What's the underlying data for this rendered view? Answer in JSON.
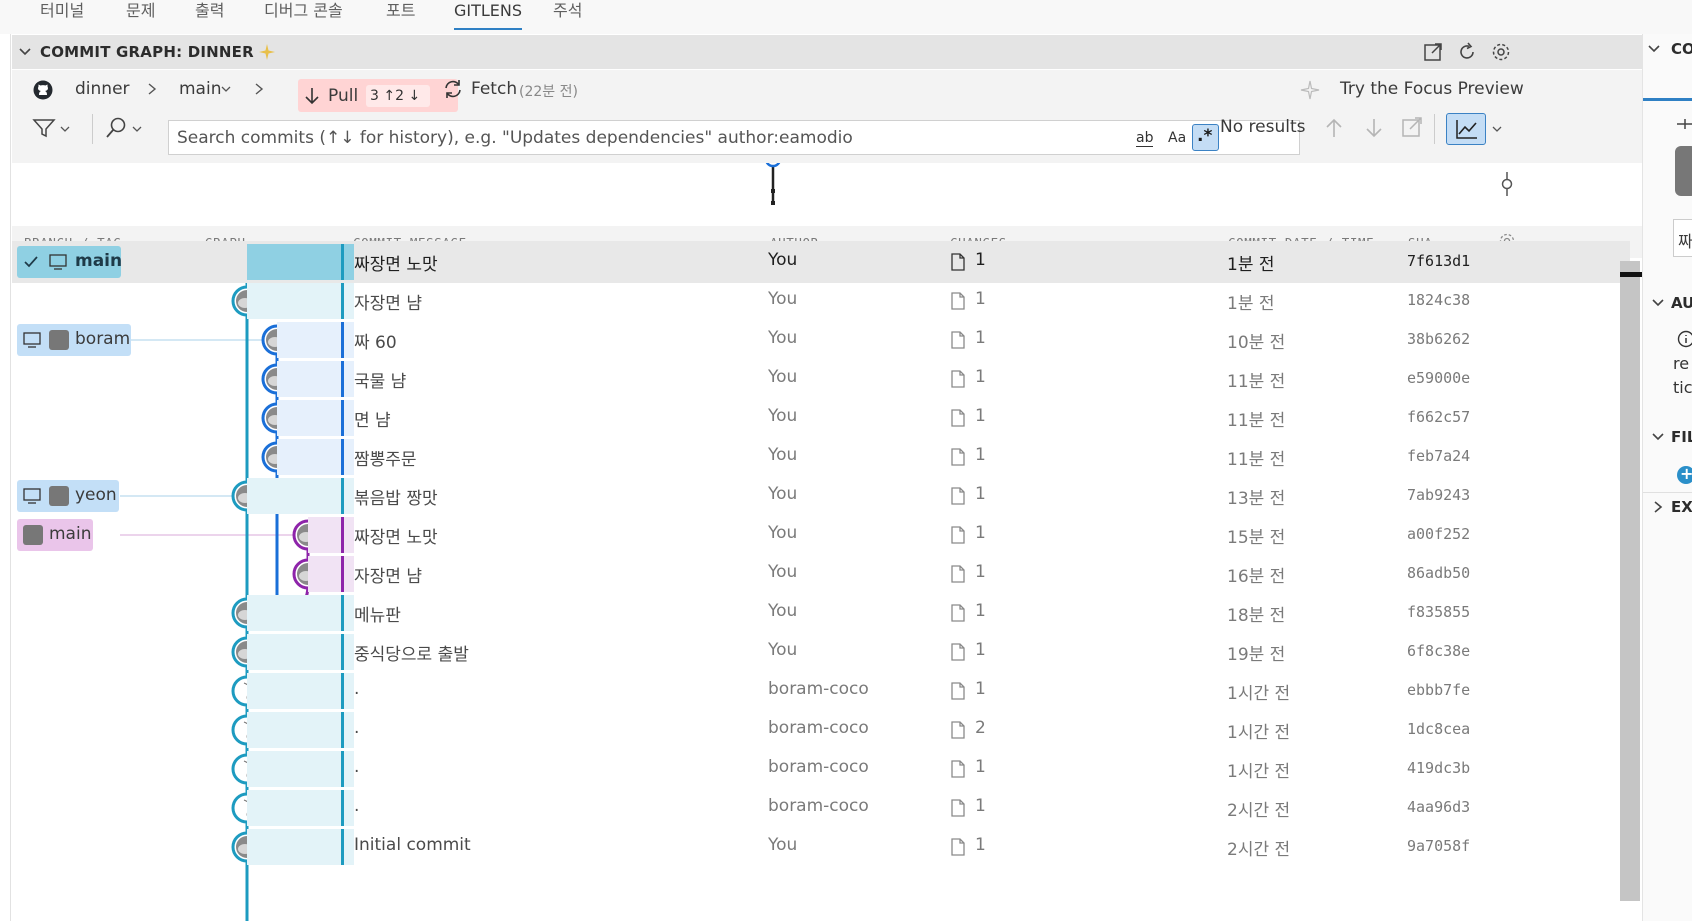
{
  "panel_tabs": [
    {
      "label": "터미널"
    },
    {
      "label": "문제"
    },
    {
      "label": "출력"
    },
    {
      "label": "디버그 콘솔"
    },
    {
      "label": "포트"
    },
    {
      "label": "GITLENS",
      "active": true
    },
    {
      "label": "주석"
    }
  ],
  "section": {
    "title": "COMMIT GRAPH: DINNER"
  },
  "toolbar": {
    "repo": "dinner",
    "branch": "main",
    "pull_label": "Pull",
    "pull_counts": "3 ↑2 ↓",
    "fetch_label": "Fetch",
    "fetch_time": "(22분 전)",
    "focus_preview": "Try the Focus Preview",
    "search_placeholder": "Search commits (↑↓ for history), e.g. \"Updates dependencies\" author:eamodio",
    "match_word": "ab",
    "match_case": "Aa",
    "regex": ".*",
    "results": "No results"
  },
  "columns": {
    "branch": "BRANCH / TAG",
    "graph": "GRAPH",
    "message": "COMMIT MESSAGE",
    "author": "AUTHOR",
    "changes": "CHANGES",
    "date": "COMMIT DATE / TIME",
    "sha": "SHA"
  },
  "commits": [
    {
      "message": "짜장면 노맛",
      "author": "You",
      "changes": "1",
      "date": "1분 전",
      "sha": "7f613d1",
      "selected": true,
      "lane": 0,
      "color": "#1d9bc0",
      "avatar": "photo",
      "chip": {
        "label": "main",
        "kind": "current"
      }
    },
    {
      "message": "자장면 냠",
      "author": "You",
      "changes": "1",
      "date": "1분 전",
      "sha": "1824c38",
      "lane": 0,
      "color": "#1d9bc0",
      "avatar": "photo"
    },
    {
      "message": "짜 60",
      "author": "You",
      "changes": "1",
      "date": "10분 전",
      "sha": "38b6262",
      "lane": 1,
      "color": "#1a6fd8",
      "avatar": "photo",
      "chip": {
        "label": "boram",
        "kind": "local"
      }
    },
    {
      "message": "국물 냠",
      "author": "You",
      "changes": "1",
      "date": "11분 전",
      "sha": "e59000e",
      "lane": 1,
      "color": "#1a6fd8",
      "avatar": "photo"
    },
    {
      "message": "면 냠",
      "author": "You",
      "changes": "1",
      "date": "11분 전",
      "sha": "f662c57",
      "lane": 1,
      "color": "#1a6fd8",
      "avatar": "photo"
    },
    {
      "message": "짬뽕주문",
      "author": "You",
      "changes": "1",
      "date": "11분 전",
      "sha": "feb7a24",
      "lane": 1,
      "color": "#1a6fd8",
      "avatar": "photo"
    },
    {
      "message": "볶음밥 짱맛",
      "author": "You",
      "changes": "1",
      "date": "13분 전",
      "sha": "7ab9243",
      "lane": 0,
      "color": "#1d9bc0",
      "avatar": "photo",
      "chip": {
        "label": "yeon",
        "kind": "local"
      }
    },
    {
      "message": "짜장면 노맛",
      "author": "You",
      "changes": "1",
      "date": "15분 전",
      "sha": "a00f252",
      "lane": 2,
      "color": "#8e24aa",
      "avatar": "photo",
      "chip": {
        "label": "main",
        "kind": "remote"
      }
    },
    {
      "message": "자장면 냠",
      "author": "You",
      "changes": "1",
      "date": "16분 전",
      "sha": "86adb50",
      "lane": 2,
      "color": "#8e24aa",
      "avatar": "photo"
    },
    {
      "message": "메뉴판",
      "author": "You",
      "changes": "1",
      "date": "18분 전",
      "sha": "f835855",
      "lane": 0,
      "color": "#1d9bc0",
      "avatar": "photo"
    },
    {
      "message": "중식당으로 출발",
      "author": "You",
      "changes": "1",
      "date": "19분 전",
      "sha": "6f8c38e",
      "lane": 0,
      "color": "#1d9bc0",
      "avatar": "photo"
    },
    {
      "message": ".",
      "author": "boram-coco",
      "changes": "1",
      "date": "1시간 전",
      "sha": "ebbb7fe",
      "lane": 0,
      "color": "#1d9bc0",
      "avatar": "face"
    },
    {
      "message": ".",
      "author": "boram-coco",
      "changes": "2",
      "date": "1시간 전",
      "sha": "1dc8cea",
      "lane": 0,
      "color": "#1d9bc0",
      "avatar": "face"
    },
    {
      "message": ".",
      "author": "boram-coco",
      "changes": "1",
      "date": "1시간 전",
      "sha": "419dc3b",
      "lane": 0,
      "color": "#1d9bc0",
      "avatar": "face"
    },
    {
      "message": ".",
      "author": "boram-coco",
      "changes": "1",
      "date": "2시간 전",
      "sha": "4aa96d3",
      "lane": 0,
      "color": "#1d9bc0",
      "avatar": "face"
    },
    {
      "message": "Initial commit",
      "author": "You",
      "changes": "1",
      "date": "2시간 전",
      "sha": "9a7058f",
      "lane": 0,
      "color": "#1d9bc0",
      "avatar": "photo"
    }
  ],
  "right_panel": {
    "heads": [
      "CO",
      "AU",
      "FIL",
      "EX"
    ],
    "snippets": [
      "짜",
      "re",
      "tic"
    ]
  }
}
